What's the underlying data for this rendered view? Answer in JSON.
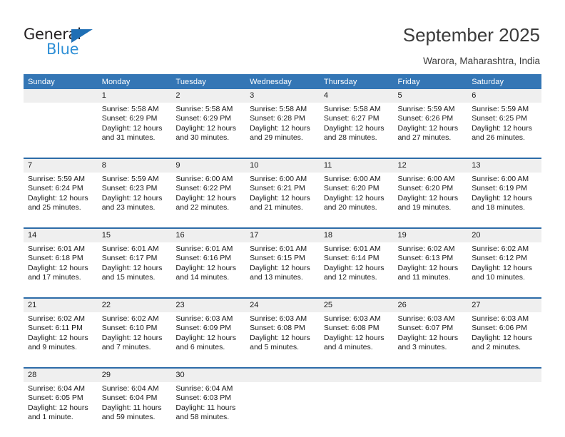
{
  "brand": {
    "name_dark": "General",
    "name_blue": "Blue",
    "color_dark": "#231f20",
    "color_blue": "#2e8fd6",
    "triangle_color": "#1f6fb5"
  },
  "header": {
    "title": "September 2025",
    "subtitle": "Warora, Maharashtra, India",
    "accent_color": "#3476b5",
    "daynum_band_color": "#efefef",
    "week_separator_color": "#2d6ca8"
  },
  "weekday_headers": [
    "Sunday",
    "Monday",
    "Tuesday",
    "Wednesday",
    "Thursday",
    "Friday",
    "Saturday"
  ],
  "weeks": [
    {
      "daynums": [
        "",
        "1",
        "2",
        "3",
        "4",
        "5",
        "6"
      ],
      "cells": [
        {
          "empty": true,
          "lines": []
        },
        {
          "empty": false,
          "lines": [
            "Sunrise: 5:58 AM",
            "Sunset: 6:29 PM",
            "Daylight: 12 hours",
            "and 31 minutes."
          ]
        },
        {
          "empty": false,
          "lines": [
            "Sunrise: 5:58 AM",
            "Sunset: 6:29 PM",
            "Daylight: 12 hours",
            "and 30 minutes."
          ]
        },
        {
          "empty": false,
          "lines": [
            "Sunrise: 5:58 AM",
            "Sunset: 6:28 PM",
            "Daylight: 12 hours",
            "and 29 minutes."
          ]
        },
        {
          "empty": false,
          "lines": [
            "Sunrise: 5:58 AM",
            "Sunset: 6:27 PM",
            "Daylight: 12 hours",
            "and 28 minutes."
          ]
        },
        {
          "empty": false,
          "lines": [
            "Sunrise: 5:59 AM",
            "Sunset: 6:26 PM",
            "Daylight: 12 hours",
            "and 27 minutes."
          ]
        },
        {
          "empty": false,
          "lines": [
            "Sunrise: 5:59 AM",
            "Sunset: 6:25 PM",
            "Daylight: 12 hours",
            "and 26 minutes."
          ]
        }
      ]
    },
    {
      "daynums": [
        "7",
        "8",
        "9",
        "10",
        "11",
        "12",
        "13"
      ],
      "cells": [
        {
          "empty": false,
          "lines": [
            "Sunrise: 5:59 AM",
            "Sunset: 6:24 PM",
            "Daylight: 12 hours",
            "and 25 minutes."
          ]
        },
        {
          "empty": false,
          "lines": [
            "Sunrise: 5:59 AM",
            "Sunset: 6:23 PM",
            "Daylight: 12 hours",
            "and 23 minutes."
          ]
        },
        {
          "empty": false,
          "lines": [
            "Sunrise: 6:00 AM",
            "Sunset: 6:22 PM",
            "Daylight: 12 hours",
            "and 22 minutes."
          ]
        },
        {
          "empty": false,
          "lines": [
            "Sunrise: 6:00 AM",
            "Sunset: 6:21 PM",
            "Daylight: 12 hours",
            "and 21 minutes."
          ]
        },
        {
          "empty": false,
          "lines": [
            "Sunrise: 6:00 AM",
            "Sunset: 6:20 PM",
            "Daylight: 12 hours",
            "and 20 minutes."
          ]
        },
        {
          "empty": false,
          "lines": [
            "Sunrise: 6:00 AM",
            "Sunset: 6:20 PM",
            "Daylight: 12 hours",
            "and 19 minutes."
          ]
        },
        {
          "empty": false,
          "lines": [
            "Sunrise: 6:00 AM",
            "Sunset: 6:19 PM",
            "Daylight: 12 hours",
            "and 18 minutes."
          ]
        }
      ]
    },
    {
      "daynums": [
        "14",
        "15",
        "16",
        "17",
        "18",
        "19",
        "20"
      ],
      "cells": [
        {
          "empty": false,
          "lines": [
            "Sunrise: 6:01 AM",
            "Sunset: 6:18 PM",
            "Daylight: 12 hours",
            "and 17 minutes."
          ]
        },
        {
          "empty": false,
          "lines": [
            "Sunrise: 6:01 AM",
            "Sunset: 6:17 PM",
            "Daylight: 12 hours",
            "and 15 minutes."
          ]
        },
        {
          "empty": false,
          "lines": [
            "Sunrise: 6:01 AM",
            "Sunset: 6:16 PM",
            "Daylight: 12 hours",
            "and 14 minutes."
          ]
        },
        {
          "empty": false,
          "lines": [
            "Sunrise: 6:01 AM",
            "Sunset: 6:15 PM",
            "Daylight: 12 hours",
            "and 13 minutes."
          ]
        },
        {
          "empty": false,
          "lines": [
            "Sunrise: 6:01 AM",
            "Sunset: 6:14 PM",
            "Daylight: 12 hours",
            "and 12 minutes."
          ]
        },
        {
          "empty": false,
          "lines": [
            "Sunrise: 6:02 AM",
            "Sunset: 6:13 PM",
            "Daylight: 12 hours",
            "and 11 minutes."
          ]
        },
        {
          "empty": false,
          "lines": [
            "Sunrise: 6:02 AM",
            "Sunset: 6:12 PM",
            "Daylight: 12 hours",
            "and 10 minutes."
          ]
        }
      ]
    },
    {
      "daynums": [
        "21",
        "22",
        "23",
        "24",
        "25",
        "26",
        "27"
      ],
      "cells": [
        {
          "empty": false,
          "lines": [
            "Sunrise: 6:02 AM",
            "Sunset: 6:11 PM",
            "Daylight: 12 hours",
            "and 9 minutes."
          ]
        },
        {
          "empty": false,
          "lines": [
            "Sunrise: 6:02 AM",
            "Sunset: 6:10 PM",
            "Daylight: 12 hours",
            "and 7 minutes."
          ]
        },
        {
          "empty": false,
          "lines": [
            "Sunrise: 6:03 AM",
            "Sunset: 6:09 PM",
            "Daylight: 12 hours",
            "and 6 minutes."
          ]
        },
        {
          "empty": false,
          "lines": [
            "Sunrise: 6:03 AM",
            "Sunset: 6:08 PM",
            "Daylight: 12 hours",
            "and 5 minutes."
          ]
        },
        {
          "empty": false,
          "lines": [
            "Sunrise: 6:03 AM",
            "Sunset: 6:08 PM",
            "Daylight: 12 hours",
            "and 4 minutes."
          ]
        },
        {
          "empty": false,
          "lines": [
            "Sunrise: 6:03 AM",
            "Sunset: 6:07 PM",
            "Daylight: 12 hours",
            "and 3 minutes."
          ]
        },
        {
          "empty": false,
          "lines": [
            "Sunrise: 6:03 AM",
            "Sunset: 6:06 PM",
            "Daylight: 12 hours",
            "and 2 minutes."
          ]
        }
      ]
    },
    {
      "daynums": [
        "28",
        "29",
        "30",
        "",
        "",
        "",
        ""
      ],
      "cells": [
        {
          "empty": false,
          "lines": [
            "Sunrise: 6:04 AM",
            "Sunset: 6:05 PM",
            "Daylight: 12 hours",
            "and 1 minute."
          ]
        },
        {
          "empty": false,
          "lines": [
            "Sunrise: 6:04 AM",
            "Sunset: 6:04 PM",
            "Daylight: 11 hours",
            "and 59 minutes."
          ]
        },
        {
          "empty": false,
          "lines": [
            "Sunrise: 6:04 AM",
            "Sunset: 6:03 PM",
            "Daylight: 11 hours",
            "and 58 minutes."
          ]
        },
        {
          "empty": true,
          "lines": []
        },
        {
          "empty": true,
          "lines": []
        },
        {
          "empty": true,
          "lines": []
        },
        {
          "empty": true,
          "lines": []
        }
      ]
    }
  ]
}
